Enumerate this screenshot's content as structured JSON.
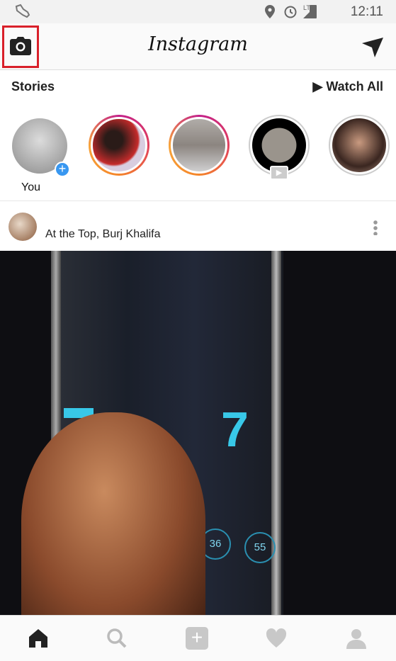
{
  "status_bar": {
    "time": "12:11",
    "network": "LTE",
    "icons": [
      "shoe-icon",
      "location-icon",
      "alarm-icon",
      "signal-icon",
      "battery-icon"
    ]
  },
  "app_bar": {
    "title": "Instagram",
    "left_icon": "camera-icon",
    "right_icon": "direct-message-icon",
    "highlight_color": "#d9202a"
  },
  "stories": {
    "title": "Stories",
    "watch_all": "Watch All",
    "items": [
      {
        "label": "You"
      },
      {
        "label": ""
      },
      {
        "label": ""
      },
      {
        "label": ""
      },
      {
        "label": ""
      }
    ]
  },
  "post": {
    "location": "At the Top, Burj Khalifa",
    "display_left": "36",
    "display_right": "55"
  },
  "bottom_nav": [
    "home-icon",
    "search-icon",
    "add-icon",
    "heart-icon",
    "profile-icon"
  ]
}
